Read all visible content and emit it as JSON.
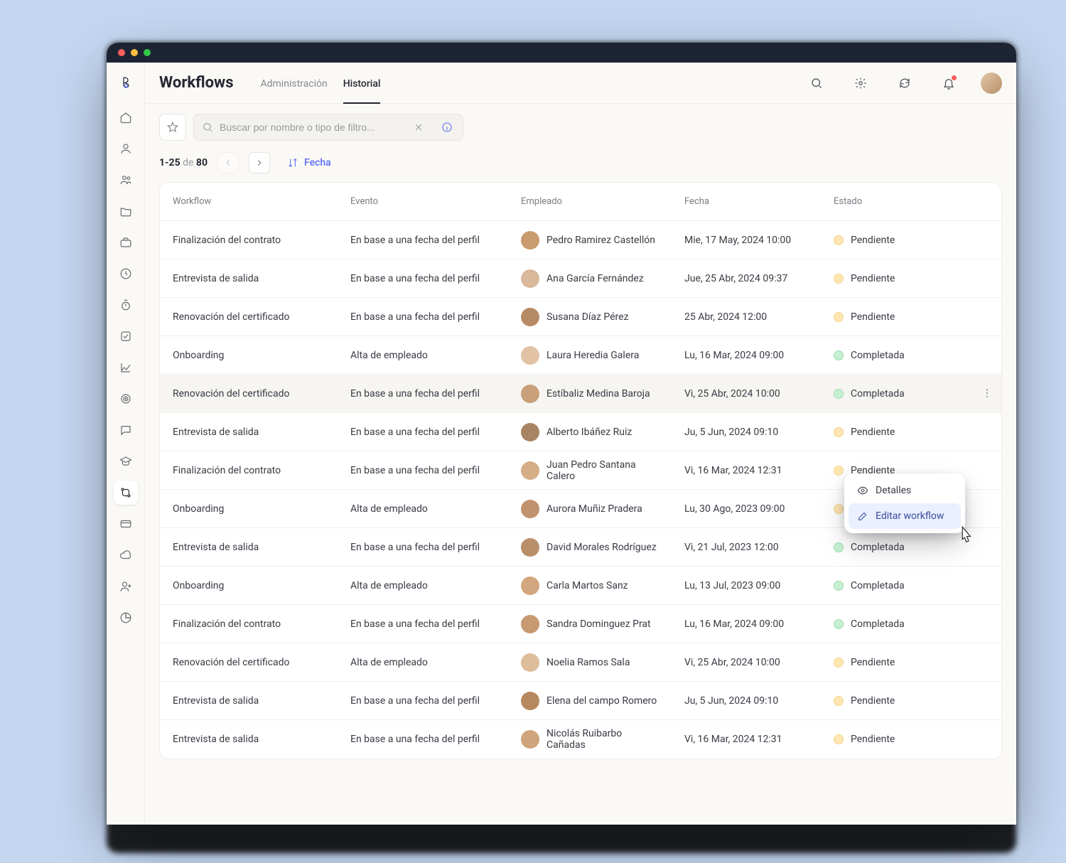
{
  "page": {
    "title": "Workflows",
    "tabs": [
      {
        "label": "Administración",
        "active": false
      },
      {
        "label": "Historial",
        "active": true
      }
    ]
  },
  "search": {
    "placeholder": "Buscar por nombre o tipo de filtro..."
  },
  "pager": {
    "range": "1-25",
    "of_label": "de",
    "total": "80"
  },
  "sort": {
    "label": "Fecha"
  },
  "columns": {
    "workflow": "Workflow",
    "event": "Evento",
    "employee": "Empleado",
    "date": "Fecha",
    "status": "Estado"
  },
  "status_labels": {
    "pending": "Pendiente",
    "done": "Completada"
  },
  "rows": [
    {
      "workflow": "Finalización del contrato",
      "event": "En base a una fecha del perfil",
      "employee": "Pedro Ramirez Castellón",
      "date": "Mie, 17 May, 2024 10:00",
      "status": "pending"
    },
    {
      "workflow": "Entrevista de salida",
      "event": "En base a una fecha del perfil",
      "employee": "Ana García Fernández",
      "date": "Jue, 25 Abr, 2024 09:37",
      "status": "pending"
    },
    {
      "workflow": "Renovación del certificado",
      "event": "En base a una fecha del perfil",
      "employee": "Susana Díaz Pérez",
      "date": "25 Abr, 2024 12:00",
      "status": "pending"
    },
    {
      "workflow": "Onboarding",
      "event": "Alta de empleado",
      "employee": "Laura Heredia Galera",
      "date": "Lu, 16 Mar, 2024 09:00",
      "status": "done"
    },
    {
      "workflow": "Renovación del certificado",
      "event": "En base a una fecha del perfil",
      "employee": "Estíbaliz Medina Baroja",
      "date": "Vi, 25 Abr, 2024 10:00",
      "status": "done",
      "hover": true,
      "show_more": true
    },
    {
      "workflow": "Entrevista de salida",
      "event": "En base a una fecha del perfil",
      "employee": "Alberto Ibáñez Ruiz",
      "date": "Ju, 5 Jun, 2024 09:10",
      "status": "pending"
    },
    {
      "workflow": "Finalización del contrato",
      "event": "En base a una fecha del perfil",
      "employee": "Juan Pedro Santana Calero",
      "date": "Vi, 16 Mar, 2024 12:31",
      "status": "pending"
    },
    {
      "workflow": "Onboarding",
      "event": "Alta de empleado",
      "employee": "Aurora Muñiz Pradera",
      "date": "Lu, 30 Ago, 2023 09:00",
      "status": "pending"
    },
    {
      "workflow": "Entrevista de salida",
      "event": "En base a una fecha del perfil",
      "employee": "David Morales Rodríguez",
      "date": "Vi, 21 Jul, 2023 12:00",
      "status": "done"
    },
    {
      "workflow": "Onboarding",
      "event": "Alta de empleado",
      "employee": "Carla Martos Sanz",
      "date": "Lu, 13 Jul, 2023 09:00",
      "status": "done"
    },
    {
      "workflow": "Finalización del contrato",
      "event": "En base a una fecha del perfil",
      "employee": "Sandra Dominguez Prat",
      "date": "Lu, 16 Mar, 2024 09:00",
      "status": "done"
    },
    {
      "workflow": "Renovación del certificado",
      "event": "Alta de empleado",
      "employee": "Noelia Ramos Sala",
      "date": "Vi, 25 Abr, 2024 10:00",
      "status": "pending"
    },
    {
      "workflow": "Entrevista de salida",
      "event": "En base a una fecha del perfil",
      "employee": "Elena del campo Romero",
      "date": "Ju, 5 Jun, 2024 09:10",
      "status": "pending"
    },
    {
      "workflow": "Entrevista de salida",
      "event": "En base a una fecha del perfil",
      "employee": "Nicolás Ruibarbo Cañadas",
      "date": "Vi, 16 Mar, 2024 12:31",
      "status": "pending"
    }
  ],
  "context_menu": {
    "details": "Detalles",
    "edit": "Editar workflow"
  },
  "avatar_colors": [
    "#c99b6e",
    "#d9b89c",
    "#b78a66",
    "#e1c2a4",
    "#caa07a",
    "#a88562",
    "#d5ae86",
    "#c0926e",
    "#b98f6a",
    "#d2a67e",
    "#c79a72",
    "#ddbd9a",
    "#b68860",
    "#cfa37b"
  ]
}
